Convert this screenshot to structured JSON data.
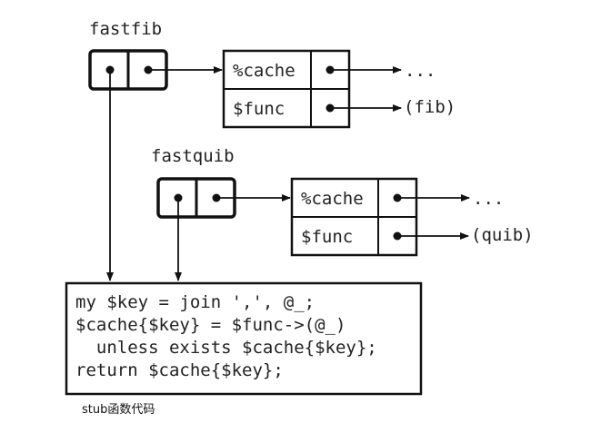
{
  "closures": [
    {
      "name": "fastfib",
      "fields": [
        {
          "label": "%cache",
          "target": "..."
        },
        {
          "label": "$func",
          "target": "(fib)"
        }
      ]
    },
    {
      "name": "fastquib",
      "fields": [
        {
          "label": "%cache",
          "target": "..."
        },
        {
          "label": "$func",
          "target": "(quib)"
        }
      ]
    }
  ],
  "code_lines": [
    "my $key = join ',', @_;",
    "$cache{$key} = $func->(@_)",
    "  unless exists $cache{$key};",
    "return $cache{$key};"
  ],
  "caption": "stub函数代码"
}
